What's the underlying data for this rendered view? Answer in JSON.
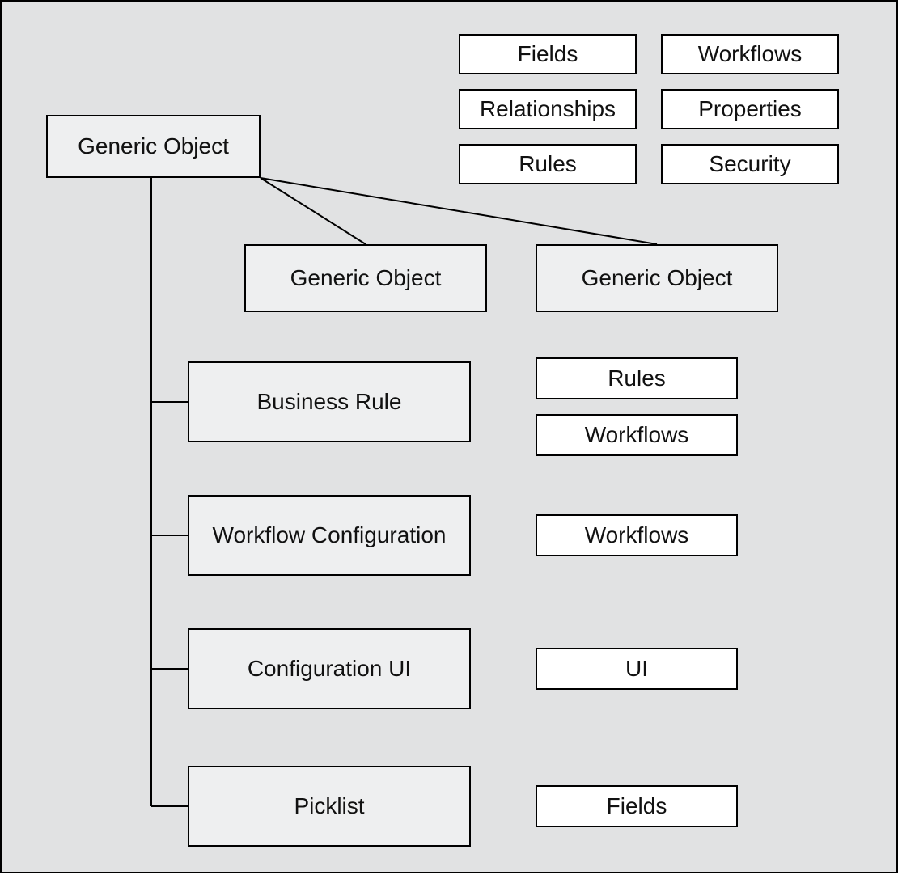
{
  "root": {
    "label": "Generic Object"
  },
  "topGrid": {
    "r0c0": "Fields",
    "r0c1": "Workflows",
    "r1c0": "Relationships",
    "r1c1": "Properties",
    "r2c0": "Rules",
    "r2c1": "Security"
  },
  "childObjects": {
    "left": {
      "label": "Generic Object"
    },
    "right": {
      "label": "Generic Object"
    }
  },
  "items": {
    "businessRule": {
      "label": "Business Rule",
      "tags": {
        "t0": "Rules",
        "t1": "Workflows"
      }
    },
    "workflowConfig": {
      "label": "Workflow Configuration",
      "tags": {
        "t0": "Workflows"
      }
    },
    "configUI": {
      "label": "Configuration UI",
      "tags": {
        "t0": "UI"
      }
    },
    "picklist": {
      "label": "Picklist",
      "tags": {
        "t0": "Fields"
      }
    }
  }
}
